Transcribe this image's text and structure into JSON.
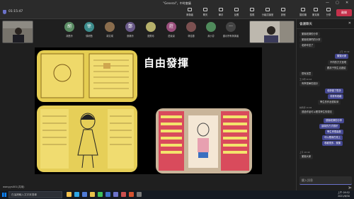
{
  "window": {
    "title": "\"General\"，中时會議",
    "controls": [
      "—",
      "▢",
      "✕"
    ]
  },
  "toolbar": {
    "elapsed": "01:15:47",
    "buttons": [
      {
        "label": "參與者",
        "icon": "people-icon"
      },
      {
        "label": "聊天",
        "icon": "chat-icon"
      },
      {
        "label": "舉手",
        "icon": "raise-hand-icon"
      },
      {
        "label": "反應",
        "icon": "reaction-icon"
      },
      {
        "label": "檢視",
        "icon": "view-icon"
      },
      {
        "label": "分組討論室",
        "icon": "rooms-icon"
      },
      {
        "label": "其他",
        "icon": "more-icon"
      },
      {
        "label": "攝影機",
        "icon": "camera-icon"
      },
      {
        "label": "麥克風",
        "icon": "mic-icon"
      },
      {
        "label": "分享",
        "icon": "share-icon"
      }
    ],
    "leave_label": "離開"
  },
  "participants": [
    {
      "name": "胡",
      "label": "胡慧玲",
      "color": "#5b8c64"
    },
    {
      "name": "徐",
      "label": "徐明慧",
      "color": "#3c8c8c"
    },
    {
      "name": "",
      "label": "郭文瑛",
      "color": "#8a6d4d"
    },
    {
      "name": "鄭",
      "label": "鄭美玲",
      "color": "#6a5a88"
    },
    {
      "name": "",
      "label": "施秀珍",
      "color": "#b6b06a"
    },
    {
      "name": "莊",
      "label": "莊淑貞",
      "color": "#9a4f7c"
    },
    {
      "name": "",
      "label": "林佳蓉",
      "color": "#7b5050"
    },
    {
      "name": "",
      "label": "黃小芬",
      "color": "#4f8a5b"
    },
    {
      "name": "···",
      "label": "顯示所有參與者",
      "color": "#444"
    }
  ],
  "slide": {
    "title": "自由發揮",
    "caption": "wangys001(共用)"
  },
  "chat": {
    "header": "會議聊天",
    "messages": [
      {
        "side": "in",
        "meta": "",
        "text": "謝謝老師的分享"
      },
      {
        "side": "in",
        "meta": "",
        "text": "謝謝老師們的分享"
      },
      {
        "side": "in",
        "meta": "",
        "text": "老師辛苦了"
      },
      {
        "side": "out",
        "meta": "上午 10:42",
        "text": "謝謝大家"
      },
      {
        "side": "in",
        "meta": "",
        "text": "不同的方式呈現"
      },
      {
        "side": "in",
        "meta": "",
        "text": "跟孩子的生活連結"
      },
      {
        "side": "in",
        "meta": "",
        "text": "很有創意"
      },
      {
        "side": "in",
        "meta": "王小明 10:44",
        "text": "有學習單的設計"
      },
      {
        "side": "out",
        "meta": "",
        "text": "老師做了很多"
      },
      {
        "side": "out",
        "meta": "",
        "text": "非常有收穫"
      },
      {
        "side": "in",
        "meta": "",
        "text": "學生的作品很精采"
      },
      {
        "side": "in",
        "meta": "林老師 10:46",
        "text": "透過作品可以看見學生的想法"
      },
      {
        "side": "out",
        "meta": "",
        "text": "感謝老師的分享"
      },
      {
        "side": "out",
        "meta": "",
        "text": "這樣的方式很好"
      },
      {
        "side": "out",
        "meta": "",
        "text": "學生會很喜歡"
      },
      {
        "side": "out",
        "meta": "",
        "text": "可以應用在班上"
      },
      {
        "side": "out",
        "meta": "",
        "text": "收穫很多，謝謝"
      },
      {
        "side": "in",
        "meta": "上午 10:49",
        "text": "謝謝大家"
      }
    ],
    "input_placeholder": "鍵入訊息"
  },
  "taskbar": {
    "search_placeholder": "在這裡輸入文字來搜尋",
    "time": "上午 09:52",
    "date": "2021/6/30",
    "apps": [
      {
        "name": "file-explorer-icon",
        "color": "#f2c04d"
      },
      {
        "name": "edge-icon",
        "color": "#2ea6e6"
      },
      {
        "name": "store-icon",
        "color": "#4e7ad6"
      },
      {
        "name": "chrome-icon",
        "color": "#e6c04a"
      },
      {
        "name": "line-icon",
        "color": "#3cbf5a"
      },
      {
        "name": "word-icon",
        "color": "#3b6fc7"
      },
      {
        "name": "teams-icon",
        "color": "#6b72c9"
      },
      {
        "name": "photo-icon",
        "color": "#c94f4f"
      },
      {
        "name": "powerpoint-icon",
        "color": "#d35230"
      },
      {
        "name": "settings-icon",
        "color": "#777"
      }
    ]
  }
}
